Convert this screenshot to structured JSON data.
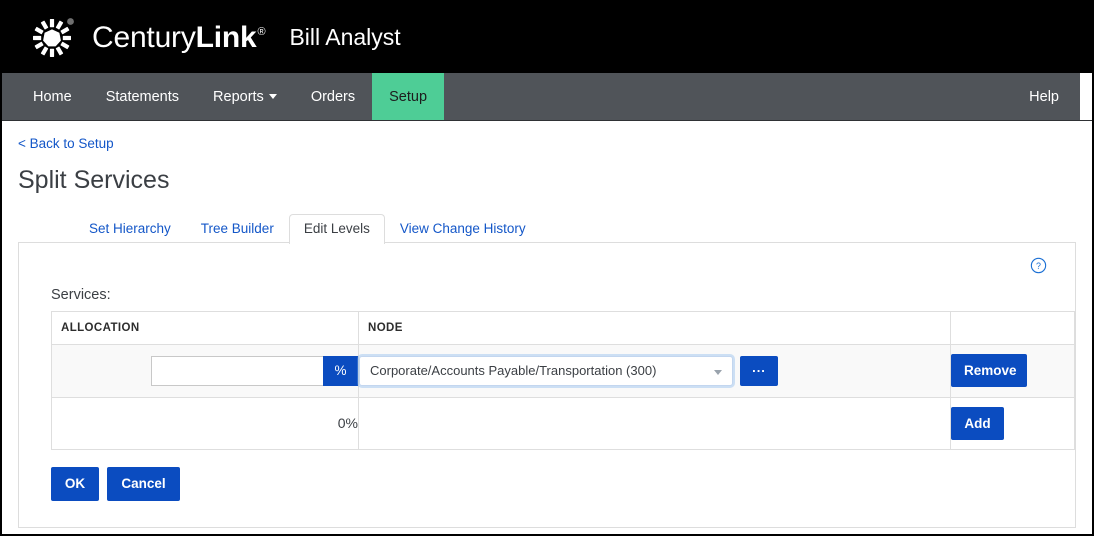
{
  "brand": {
    "logo_icon": "centurylink-starburst-icon",
    "name_light": "Century",
    "name_bold": "Link",
    "registered_mark": "®",
    "app_name": "Bill Analyst"
  },
  "nav": {
    "items": [
      {
        "label": "Home",
        "active": false,
        "has_caret": false
      },
      {
        "label": "Statements",
        "active": false,
        "has_caret": false
      },
      {
        "label": "Reports",
        "active": false,
        "has_caret": true
      },
      {
        "label": "Orders",
        "active": false,
        "has_caret": false
      },
      {
        "label": "Setup",
        "active": true,
        "has_caret": false
      }
    ],
    "help_label": "Help",
    "active_color": "#4ecd96",
    "bar_color": "#505459"
  },
  "page": {
    "back_link": "< Back to Setup",
    "title": "Split Services"
  },
  "tabs": [
    {
      "label": "Set Hierarchy",
      "active": false
    },
    {
      "label": "Tree Builder",
      "active": false
    },
    {
      "label": "Edit Levels",
      "active": true
    },
    {
      "label": "View Change History",
      "active": false
    }
  ],
  "panel": {
    "help_icon": "question-circle-icon",
    "services_label": "Services:",
    "table": {
      "headers": [
        "ALLOCATION",
        "NODE",
        ""
      ],
      "rows": [
        {
          "allocation_value": "",
          "allocation_placeholder": "",
          "percent_addon": "%",
          "node_value": "Corporate/Accounts Payable/Transportation (300)",
          "node_more_label": "...",
          "action_label": "Remove"
        }
      ],
      "total_row": {
        "total_label": "0%",
        "action_label": "Add"
      }
    },
    "footer": {
      "ok_label": "OK",
      "cancel_label": "Cancel"
    }
  },
  "colors": {
    "accent_blue": "#0b4cc0",
    "link_blue": "#1457c8",
    "nav_green": "#4ecd96",
    "masthead_black": "#000000"
  }
}
